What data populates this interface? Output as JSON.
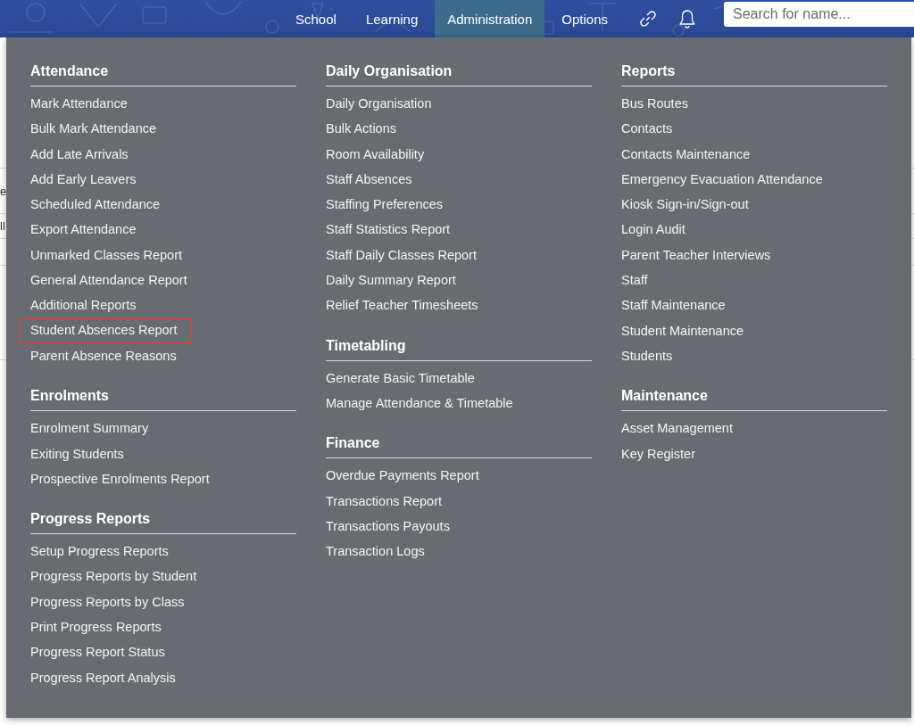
{
  "header": {
    "nav": [
      {
        "label": "School",
        "selected": false
      },
      {
        "label": "Learning",
        "selected": false
      },
      {
        "label": "Administration",
        "selected": true
      },
      {
        "label": "Options",
        "selected": false
      }
    ],
    "search": {
      "placeholder": "Search for name..."
    }
  },
  "page_behind": {
    "fragments": [
      "e",
      "ll"
    ]
  },
  "menu": {
    "columns": [
      {
        "sections": [
          {
            "title": "Attendance",
            "items": [
              {
                "label": "Mark Attendance",
                "highlighted": false
              },
              {
                "label": "Bulk Mark Attendance",
                "highlighted": false
              },
              {
                "label": "Add Late Arrivals",
                "highlighted": false
              },
              {
                "label": "Add Early Leavers",
                "highlighted": false
              },
              {
                "label": "Scheduled Attendance",
                "highlighted": false
              },
              {
                "label": "Export Attendance",
                "highlighted": false
              },
              {
                "label": "Unmarked Classes Report",
                "highlighted": false
              },
              {
                "label": "General Attendance Report",
                "highlighted": false
              },
              {
                "label": "Additional Reports",
                "highlighted": false
              },
              {
                "label": "Student Absences Report",
                "highlighted": true
              },
              {
                "label": "Parent Absence Reasons",
                "highlighted": false
              }
            ]
          },
          {
            "title": "Enrolments",
            "items": [
              {
                "label": "Enrolment Summary",
                "highlighted": false
              },
              {
                "label": "Exiting Students",
                "highlighted": false
              },
              {
                "label": "Prospective Enrolments Report",
                "highlighted": false
              }
            ]
          },
          {
            "title": "Progress Reports",
            "items": [
              {
                "label": "Setup Progress Reports",
                "highlighted": false
              },
              {
                "label": "Progress Reports by Student",
                "highlighted": false
              },
              {
                "label": "Progress Reports by Class",
                "highlighted": false
              },
              {
                "label": "Print Progress Reports",
                "highlighted": false
              },
              {
                "label": "Progress Report Status",
                "highlighted": false
              },
              {
                "label": "Progress Report Analysis",
                "highlighted": false
              }
            ]
          }
        ]
      },
      {
        "sections": [
          {
            "title": "Daily Organisation",
            "items": [
              {
                "label": "Daily Organisation",
                "highlighted": false
              },
              {
                "label": "Bulk Actions",
                "highlighted": false
              },
              {
                "label": "Room Availability",
                "highlighted": false
              },
              {
                "label": "Staff Absences",
                "highlighted": false
              },
              {
                "label": "Staffing Preferences",
                "highlighted": false
              },
              {
                "label": "Staff Statistics Report",
                "highlighted": false
              },
              {
                "label": "Staff Daily Classes Report",
                "highlighted": false
              },
              {
                "label": "Daily Summary Report",
                "highlighted": false
              },
              {
                "label": "Relief Teacher Timesheets",
                "highlighted": false
              }
            ]
          },
          {
            "title": "Timetabling",
            "items": [
              {
                "label": "Generate Basic Timetable",
                "highlighted": false
              },
              {
                "label": "Manage Attendance & Timetable",
                "highlighted": false
              }
            ]
          },
          {
            "title": "Finance",
            "items": [
              {
                "label": "Overdue Payments Report",
                "highlighted": false
              },
              {
                "label": "Transactions Report",
                "highlighted": false
              },
              {
                "label": "Transactions Payouts",
                "highlighted": false
              },
              {
                "label": "Transaction Logs",
                "highlighted": false
              }
            ]
          }
        ]
      },
      {
        "sections": [
          {
            "title": "Reports",
            "items": [
              {
                "label": "Bus Routes",
                "highlighted": false
              },
              {
                "label": "Contacts",
                "highlighted": false
              },
              {
                "label": "Contacts Maintenance",
                "highlighted": false
              },
              {
                "label": "Emergency Evacuation Attendance",
                "highlighted": false
              },
              {
                "label": "Kiosk Sign-in/Sign-out",
                "highlighted": false
              },
              {
                "label": "Login Audit",
                "highlighted": false
              },
              {
                "label": "Parent Teacher Interviews",
                "highlighted": false
              },
              {
                "label": "Staff",
                "highlighted": false
              },
              {
                "label": "Staff Maintenance",
                "highlighted": false
              },
              {
                "label": "Student Maintenance",
                "highlighted": false
              },
              {
                "label": "Students",
                "highlighted": false
              }
            ]
          },
          {
            "title": "Maintenance",
            "items": [
              {
                "label": "Asset Management",
                "highlighted": false
              },
              {
                "label": "Key Register",
                "highlighted": false
              }
            ]
          }
        ]
      }
    ]
  }
}
